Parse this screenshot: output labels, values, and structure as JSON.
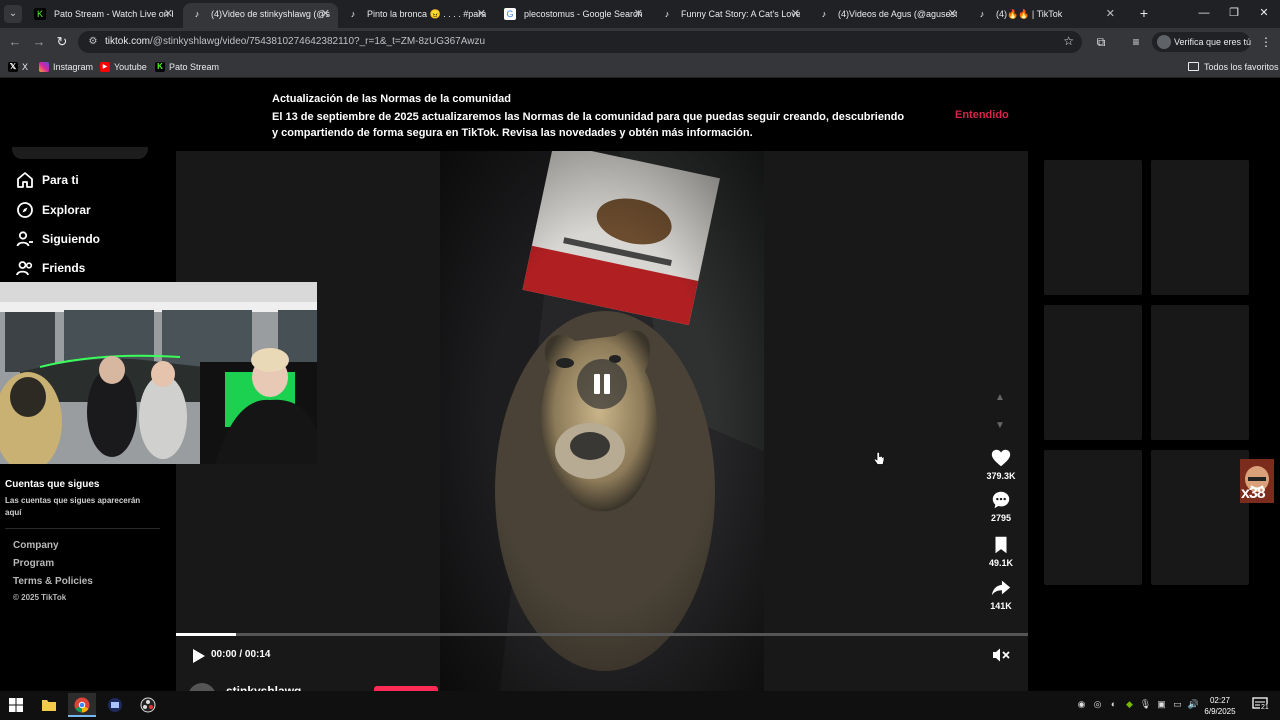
{
  "browser": {
    "tabs": [
      {
        "title": "Pato Stream - Watch Live on Ki",
        "favicon": "kick",
        "active": false
      },
      {
        "title": "(4)Video de stinkyshlawg (@sti",
        "favicon": "tiktok",
        "active": true
      },
      {
        "title": "Pinto la bronca 😠 . . . . #parati",
        "favicon": "tiktok",
        "active": false
      },
      {
        "title": "plecostomus - Google Search",
        "favicon": "google",
        "active": false
      },
      {
        "title": "Funny Cat Story: A Cat's Love fo",
        "favicon": "tiktok",
        "active": false
      },
      {
        "title": "(4)Videos de Agus (@aguseste",
        "favicon": "tiktok",
        "active": false
      },
      {
        "title": "(4)🔥🔥 | TikTok",
        "favicon": "tiktok",
        "active": false
      }
    ],
    "url_host": "tiktok.com",
    "url_path": "/@stinkyshlawg/video/7543810274642382110?_r=1&_t=ZM-8zUG367Awzu",
    "profile_label": "Verifica que eres tú",
    "bookmarks": [
      {
        "label": "X",
        "icon": "x-icon"
      },
      {
        "label": "Instagram",
        "icon": "instagram-icon"
      },
      {
        "label": "Youtube",
        "icon": "youtube-icon"
      },
      {
        "label": "Pato Stream",
        "icon": "kick-icon"
      }
    ],
    "all_bookmarks": "Todos los favoritos"
  },
  "banner": {
    "title": "Actualización de las Normas de la comunidad",
    "text": "El 13 de septiembre de 2025 actualizaremos las Normas de la comunidad para que puedas seguir creando, descubriendo y compartiendo de forma segura en TikTok. Revisa las novedades y obtén más información.",
    "button": "Entendido"
  },
  "sidebar": {
    "nav": [
      {
        "label": "Para ti",
        "icon": "home-icon"
      },
      {
        "label": "Explorar",
        "icon": "compass-icon"
      },
      {
        "label": "Siguiendo",
        "icon": "following-icon"
      },
      {
        "label": "Friends",
        "icon": "friends-icon"
      }
    ],
    "following_title": "Cuentas que sigues",
    "following_sub": "Las cuentas que sigues aparecerán aquí",
    "footer_links": [
      "Company",
      "Program",
      "Terms & Policies"
    ],
    "copyright": "© 2025 TikTok"
  },
  "player": {
    "likes": "379.3K",
    "comments": "2795",
    "saves": "49.1K",
    "shares": "141K",
    "time": "00:00 / 00:14",
    "progress_fraction": 0.07,
    "creator": "stinkyshlawg"
  },
  "overlay": {
    "multiplier": "x38"
  },
  "taskbar": {
    "time": "02:27",
    "date": "6/9/2025",
    "notifications": "21"
  },
  "colors": {
    "accent": "#fe2c55",
    "chrome_dark": "#202124",
    "chrome_mid": "#35363a",
    "page_bg": "#000000"
  }
}
